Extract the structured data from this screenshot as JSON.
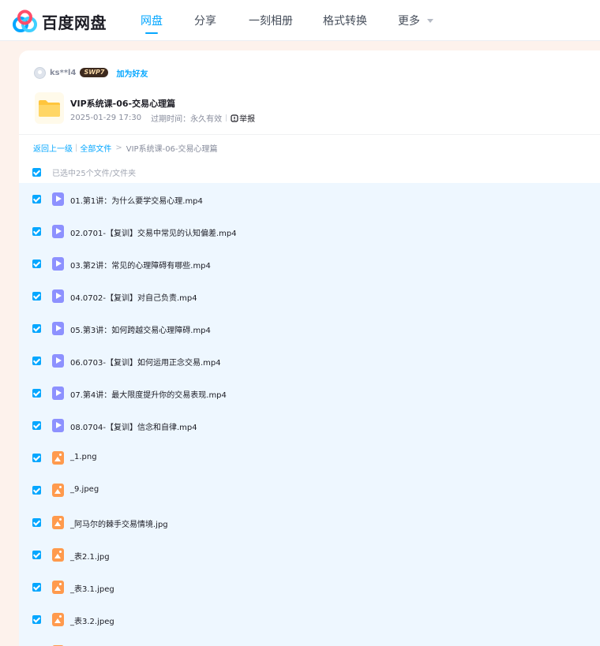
{
  "brand": {
    "name": "百度网盘"
  },
  "nav": {
    "items": [
      {
        "label": "网盘",
        "active": true
      },
      {
        "label": "分享",
        "active": false
      },
      {
        "label": "一刻相册",
        "active": false
      },
      {
        "label": "格式转换",
        "active": false
      },
      {
        "label": "更多",
        "active": false
      }
    ]
  },
  "share": {
    "user": "ks**l4",
    "badge": "SWP7",
    "add_friend": "加为好友",
    "folder_title": "VIP系统课-06-交易心理篇",
    "date": "2025-01-29 17:30",
    "expire": "过期时间：永久有效",
    "report": "举报"
  },
  "breadcrumb": {
    "back": "返回上一级",
    "all_files": "全部文件",
    "current": "VIP系统课-06-交易心理篇"
  },
  "selection": {
    "text": "已选中25个文件/文件夹"
  },
  "files": [
    {
      "name": "01.第1讲：为什么要学交易心理.mp4",
      "type": "video",
      "icon": "video-file-icon",
      "checked": true
    },
    {
      "name": "02.0701-【复训】交易中常见的认知偏差.mp4",
      "type": "video",
      "icon": "video-file-icon",
      "checked": true
    },
    {
      "name": "03.第2讲：常见的心理障碍有哪些.mp4",
      "type": "video",
      "icon": "video-file-icon",
      "checked": true
    },
    {
      "name": "04.0702-【复训】对自己负责.mp4",
      "type": "video",
      "icon": "video-file-icon",
      "checked": true
    },
    {
      "name": "05.第3讲：如何跨越交易心理障碍.mp4",
      "type": "video",
      "icon": "video-file-icon",
      "checked": true
    },
    {
      "name": "06.0703-【复训】如何运用正念交易.mp4",
      "type": "video",
      "icon": "video-file-icon",
      "checked": true
    },
    {
      "name": "07.第4讲：最大限度提升你的交易表现.mp4",
      "type": "video",
      "icon": "video-file-icon",
      "checked": true
    },
    {
      "name": "08.0704-【复训】信念和自律.mp4",
      "type": "video",
      "icon": "video-file-icon",
      "checked": true
    },
    {
      "name": "_1.png",
      "type": "image",
      "icon": "image-file-icon",
      "checked": true
    },
    {
      "name": "_9.jpeg",
      "type": "image",
      "icon": "image-file-icon",
      "checked": true
    },
    {
      "name": "_阿马尔的棘手交易情境.jpg",
      "type": "image",
      "icon": "image-file-icon",
      "checked": true
    },
    {
      "name": "_表2.1.jpg",
      "type": "image",
      "icon": "image-file-icon",
      "checked": true
    },
    {
      "name": "_表3.1.jpeg",
      "type": "image",
      "icon": "image-file-icon",
      "checked": true
    },
    {
      "name": "_表3.2.jpeg",
      "type": "image",
      "icon": "image-file-icon",
      "checked": true
    },
    {
      "name": "",
      "type": "image",
      "icon": "image-file-icon",
      "checked": true
    }
  ],
  "colors": {
    "accent": "#06a7ff",
    "video_icon": "#8d91ff",
    "image_icon": "#ff9a4d",
    "list_bg": "#eef7ff",
    "page_bg": "#fdf2ec"
  }
}
